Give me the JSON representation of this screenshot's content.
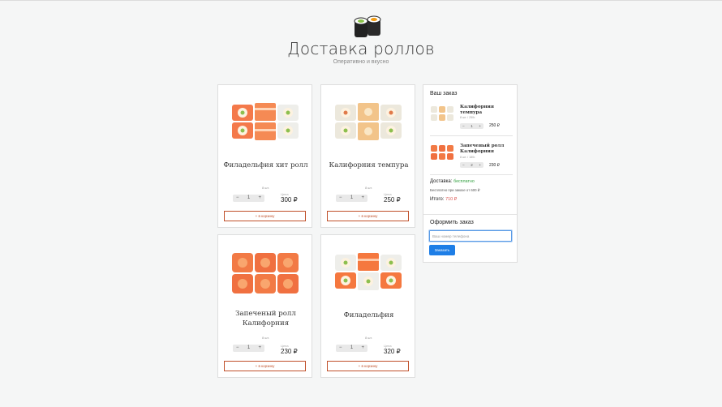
{
  "header": {
    "title": "Доставка роллов",
    "subtitle": "Оперативно и вкусно"
  },
  "products": [
    {
      "name": "Филадельфия хит ролл",
      "weight": "8 шт.",
      "qty": "1",
      "price_label": "Цена",
      "price": "300 ₽",
      "button": "+ в корзину"
    },
    {
      "name": "Калифорния темпура",
      "weight": "8 шт.",
      "qty": "1",
      "price_label": "Цена",
      "price": "250 ₽",
      "button": "+ в корзину"
    },
    {
      "name": "Запеченый ролл Калифорния",
      "weight": "8 шт.",
      "qty": "1",
      "price_label": "Цена",
      "price": "230 ₽",
      "button": "+ в корзину"
    },
    {
      "name": "Филадельфия",
      "weight": "8 шт.",
      "qty": "1",
      "price_label": "Цена",
      "price": "320 ₽",
      "button": "+ в корзину"
    }
  ],
  "stepper": {
    "minus": "−",
    "plus": "+"
  },
  "order": {
    "title": "Ваш заказ",
    "items": [
      {
        "name": "Калифорния темпура",
        "meta": "8 шт. / 250г.",
        "qty": "1",
        "price": "250 ₽"
      },
      {
        "name": "Запеченый ролл Калифорния",
        "meta": "8 шт. / 180г.",
        "qty": "2",
        "price": "230 ₽"
      }
    ],
    "delivery_label": "Доставка:",
    "delivery_value": "бесплатно",
    "free_note": "Бесплатно при заказе от 600 ₽",
    "total_label": "Итого:",
    "total_value": "710 ₽",
    "checkout_title": "Оформить заказ",
    "phone_placeholder": "Ваш номер телефона",
    "submit_label": "Заказать"
  },
  "colors": {
    "accent_blue": "#1e7ee6",
    "cart_border": "#c0502a",
    "free_green": "#2e9e3c",
    "total_red": "#d9534f"
  }
}
